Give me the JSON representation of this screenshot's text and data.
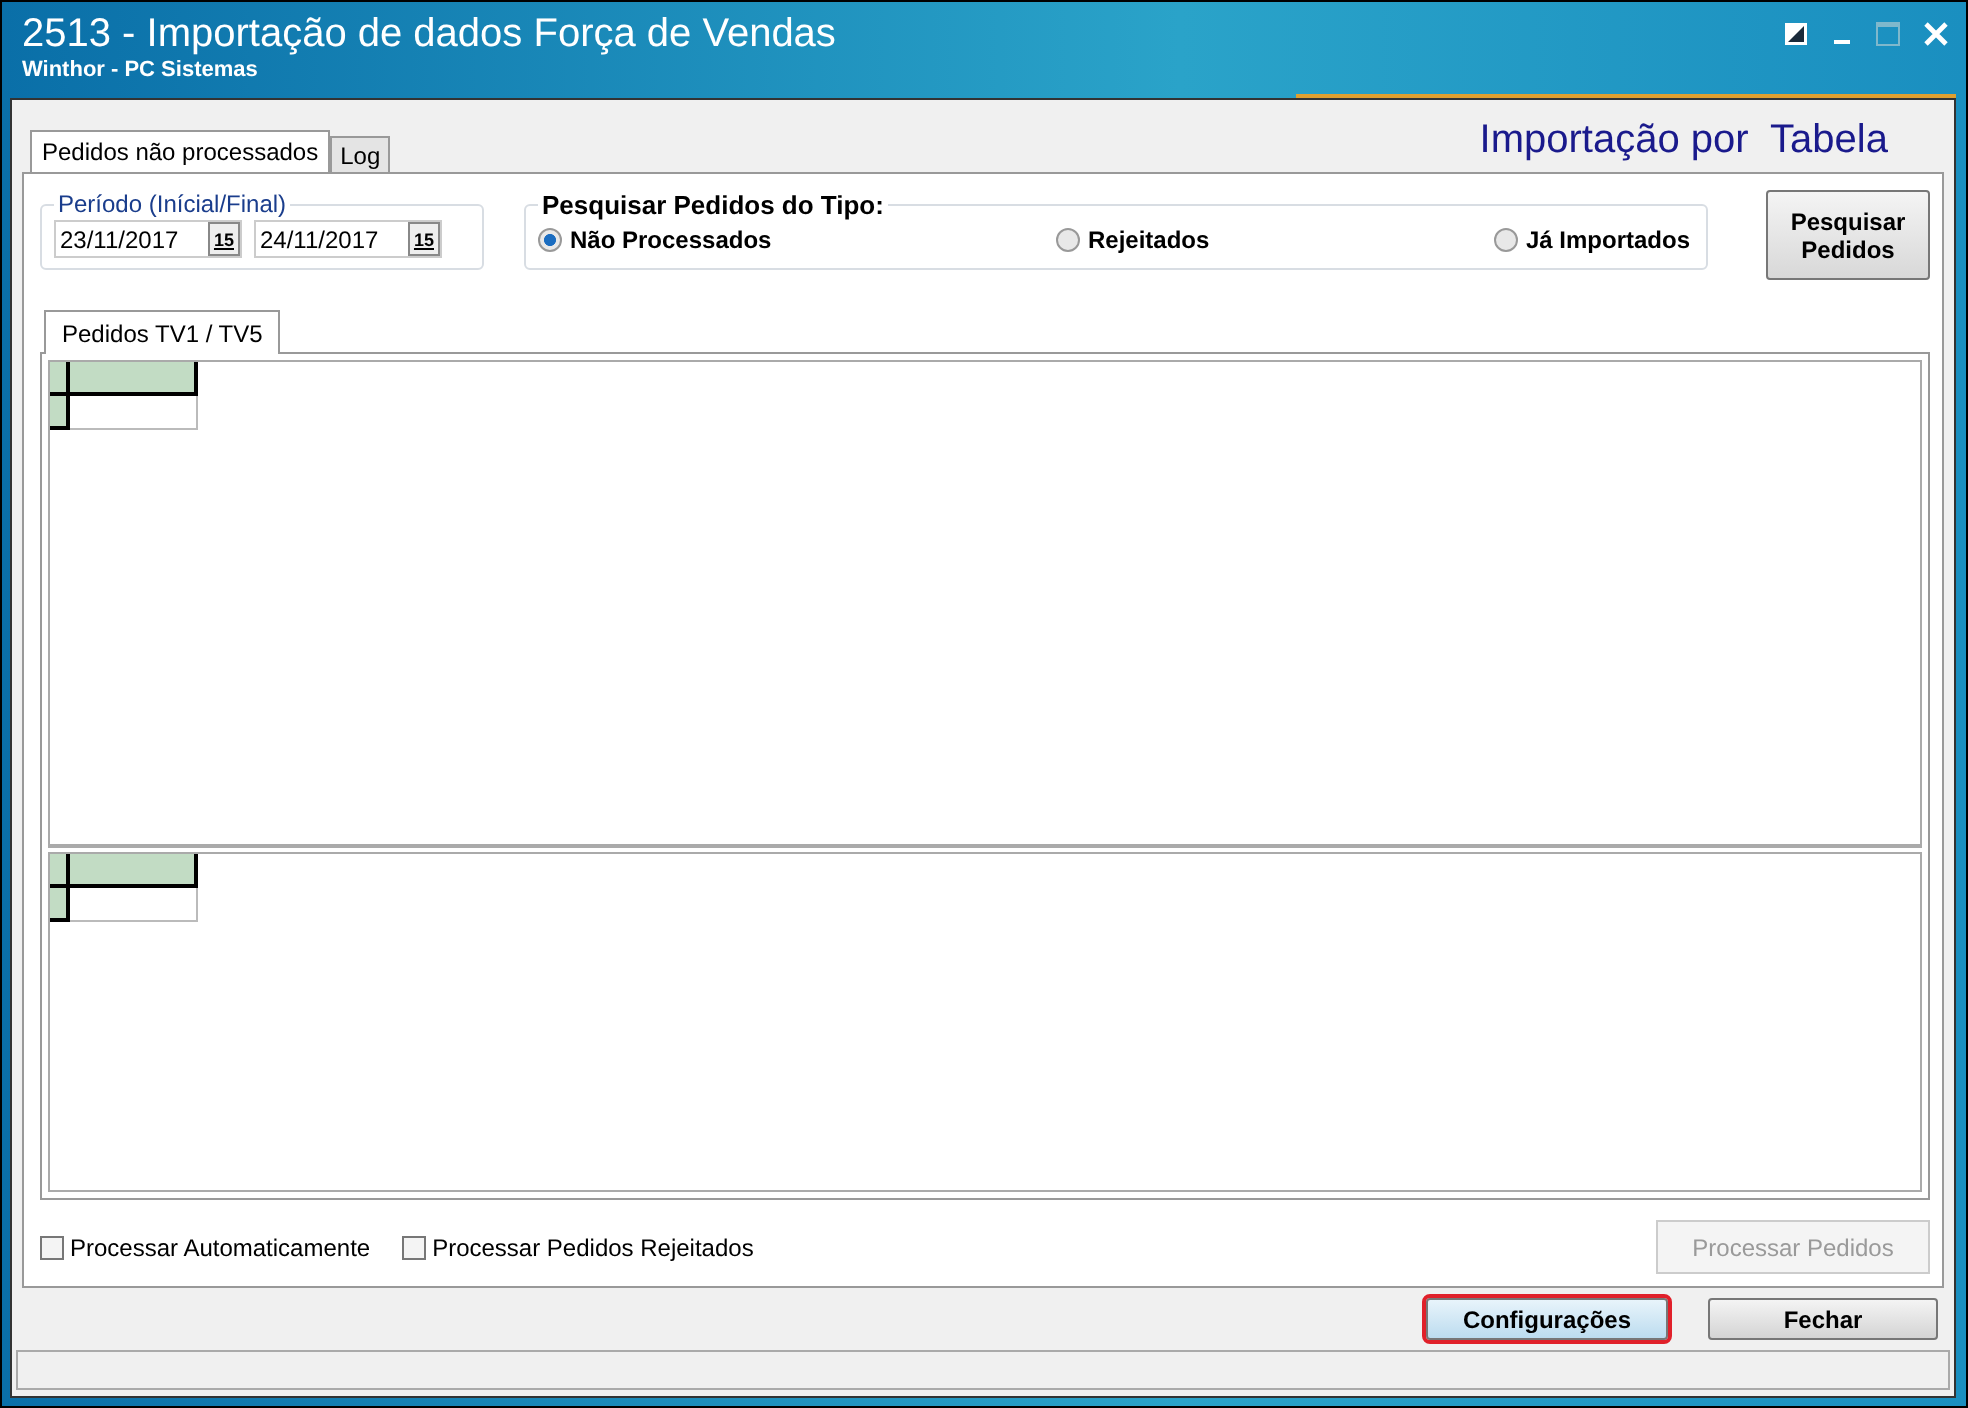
{
  "window": {
    "title": "2513 - Importação de dados Força de Vendas",
    "subtitle": "Winthor - PC Sistemas"
  },
  "tabs": [
    {
      "label": "Pedidos não processados",
      "selected": true
    },
    {
      "label": "Log",
      "selected": false
    }
  ],
  "heading": "Importação por  Tabela",
  "period": {
    "legend": "Período (Inícial/Final)",
    "dates": [
      {
        "value": "23/11/2017",
        "calendar_label": "15"
      },
      {
        "value": "24/11/2017",
        "calendar_label": "15"
      }
    ]
  },
  "search_type": {
    "legend": "Pesquisar Pedidos do Tipo:",
    "options": [
      {
        "label": "Não Processados",
        "selected": true
      },
      {
        "label": "Rejeitados",
        "selected": false
      },
      {
        "label": "Já Importados",
        "selected": false
      }
    ]
  },
  "search_button": "Pesquisar Pedidos",
  "inner_tabs": [
    "Pedidos TV1 / TV5"
  ],
  "options": [
    {
      "label": "Processar Automaticamente",
      "checked": false
    },
    {
      "label": "Processar Pedidos Rejeitados",
      "checked": false
    }
  ],
  "process_button": {
    "label": "Processar Pedidos",
    "disabled": true
  },
  "footer_buttons": [
    {
      "label": "Configurações",
      "highlighted": true
    },
    {
      "label": "Fechar",
      "highlighted": false
    }
  ]
}
